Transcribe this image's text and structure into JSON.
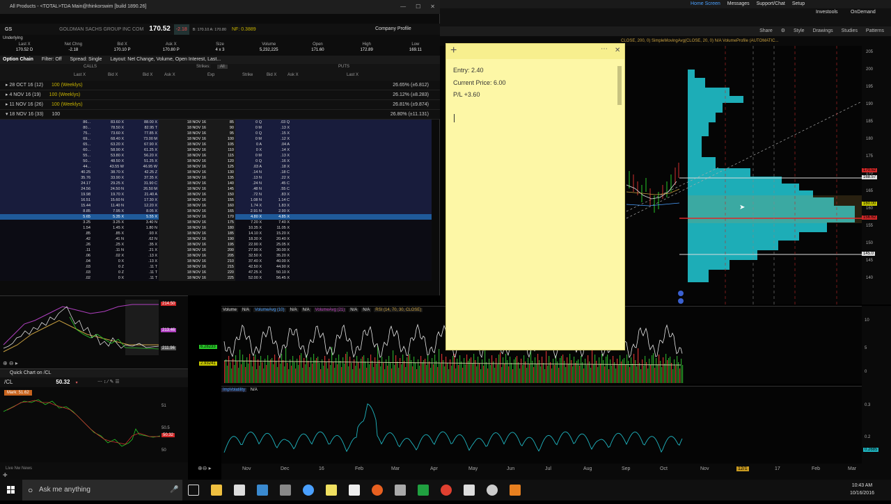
{
  "left_window": {
    "title": "All Products - <TOTAL>TDA Main@thinkorswim [build 1890.26]",
    "symbol": "GS",
    "company": "GOLDMAN SACHS GROUP INC COM",
    "last": "170.52",
    "change": "-2.18",
    "bid_ask": "B: 170.10  A: 170.80",
    "pct": "NF: 0.3889",
    "company_profile": "Company Profile",
    "underlying_label": "Underlying",
    "underlying_headers": [
      "Last X",
      "Net Chng",
      "Bid X",
      "Ask X",
      "Size",
      "Volume",
      "Open",
      "High",
      "Low"
    ],
    "underlying_values": [
      "170.52 D",
      "-2.18",
      "170.10 P",
      "170.80 P",
      "4 x 3",
      "5,232,225",
      "171.60",
      "172.89",
      "169.11"
    ],
    "option_chain_label": "Option Chain",
    "filter": "Filter: Off",
    "spread": "Spread: Single",
    "layout": "Layout: Net Change, Volume, Open Interest, Last...",
    "calls_label": "CALLS",
    "puts_label": "PUTS",
    "strikes_label": "Strikes:",
    "strikes_value": "All",
    "call_cols": [
      "Last X",
      "Net Chng",
      "Bid X",
      "Ask X"
    ],
    "put_cols": [
      "Bid X",
      "Ask X",
      "Last X",
      "Net Chng"
    ],
    "exp_col": "Exp",
    "strike_col": "Strike",
    "expirations": [
      {
        "label": "28 OCT 16",
        "days": "(12)",
        "mult": "100 (Weeklys)",
        "iv": "26.65% (±6.812)"
      },
      {
        "label": "4 NOV 16",
        "days": "(19)",
        "mult": "100 (Weeklys)",
        "iv": "26.12% (±8.283)"
      },
      {
        "label": "11 NOV 16",
        "days": "(26)",
        "mult": "100 (Weeklys)",
        "iv": "26.81% (±9.874)"
      },
      {
        "label": "18 NOV 16",
        "days": "(33)",
        "mult": "100",
        "iv": "26.80% (±11.131)"
      }
    ],
    "chain_rows": [
      {
        "strike": "85",
        "call_last": "86...",
        "call_bid": "83.60 X",
        "call_ask": "88.00 X",
        "put_bid": "0 Q",
        "put_ask": ".03 Q",
        "t": "itm"
      },
      {
        "strike": "90",
        "call_last": "80...",
        "call_bid": "78.50 X",
        "call_ask": "82.95 T",
        "put_bid": "0 M",
        "put_ask": ".13 X",
        "t": "itm"
      },
      {
        "strike": "95",
        "call_last": "75...",
        "call_bid": "73.60 X",
        "call_ask": "77.85 X",
        "put_bid": "0 Q",
        "put_ask": ".15 X",
        "t": "itm"
      },
      {
        "strike": "100",
        "call_last": "69...",
        "call_bid": "68.40 X",
        "call_ask": "73.00 M",
        "put_bid": "0 M",
        "put_ask": ".12 X",
        "t": "itm"
      },
      {
        "strike": "105",
        "call_last": "65...",
        "call_bid": "63.20 X",
        "call_ask": "67.90 X",
        "put_bid": "0 A",
        "put_ask": ".04 A",
        "t": "itm"
      },
      {
        "strike": "110",
        "call_last": "60...",
        "call_bid": "58.90 X",
        "call_ask": "61.25 X",
        "put_bid": "0 X",
        "put_ask": ".14 X",
        "t": "itm"
      },
      {
        "strike": "115",
        "call_last": "55...",
        "call_bid": "53.80 X",
        "call_ask": "56.20 X",
        "put_bid": "0 M",
        "put_ask": ".13 X",
        "t": "itm"
      },
      {
        "strike": "120",
        "call_last": "50...",
        "call_bid": "48.50 X",
        "call_ask": "51.25 X",
        "put_bid": "0 Q",
        "put_ask": ".16 X",
        "t": "itm"
      },
      {
        "strike": "125",
        "call_last": "44...",
        "call_bid": "43.55 W",
        "call_ask": "46.95 W",
        "put_bid": ".03 A",
        "put_ask": ".18 X",
        "t": "itm"
      },
      {
        "strike": "130",
        "call_last": "40.25",
        "call_bid": "38.70 X",
        "call_ask": "42.25 Z",
        "put_bid": ".14 N",
        "put_ask": ".18 C",
        "t": "itm"
      },
      {
        "strike": "135",
        "call_last": "35.76",
        "call_bid": "33.90 X",
        "call_ask": "37.35 X",
        "put_bid": ".13 N",
        "put_ask": ".22 X",
        "t": "itm"
      },
      {
        "strike": "140",
        "call_last": "24.17",
        "call_bid": "29.25 X",
        "call_ask": "31.90 C",
        "put_bid": ".24 N",
        "put_ask": ".45 C",
        "t": "itm"
      },
      {
        "strike": "145",
        "call_last": "24.56",
        "call_bid": "24.50 N",
        "call_ask": "26.50 M",
        "put_bid": ".48 N",
        "put_ask": ".55 C",
        "t": "itm"
      },
      {
        "strike": "150",
        "call_last": "19.98",
        "call_bid": "19.70 X",
        "call_ask": "21.40 A",
        "put_bid": ".72 N",
        "put_ask": ".83 X",
        "t": "itm"
      },
      {
        "strike": "155",
        "call_last": "16.51",
        "call_bid": "15.60 N",
        "call_ask": "17.30 X",
        "put_bid": "1.08 N",
        "put_ask": "1.14 C",
        "t": "itm"
      },
      {
        "strike": "160",
        "call_last": "15.44",
        "call_bid": "11.40 N",
        "call_ask": "12.20 X",
        "put_bid": "1.74 X",
        "put_ask": "1.83 X",
        "t": "itm"
      },
      {
        "strike": "165",
        "call_last": "8.85",
        "call_bid": "7.95 X",
        "call_ask": "8.05 X",
        "put_bid": "2.91 N",
        "put_ask": "2.90 X",
        "t": "itm"
      },
      {
        "strike": "170",
        "call_last": "5.65",
        "call_bid": "5.35 X",
        "call_ask": "5.55 X",
        "put_bid": "4.80 X",
        "put_ask": "4.85 X",
        "t": "sel"
      },
      {
        "strike": "175",
        "call_last": "3.25",
        "call_bid": "3.25 X",
        "call_ask": "3.40 N",
        "put_bid": "7.20 X",
        "put_ask": "7.40 X",
        "t": "otm"
      },
      {
        "strike": "180",
        "call_last": "1.54",
        "call_bid": "1.45 X",
        "call_ask": "1.80 N",
        "put_bid": "10.35 X",
        "put_ask": "11.05 X",
        "t": "otm"
      },
      {
        "strike": "185",
        "call_last": ".85",
        "call_bid": ".85 X",
        "call_ask": ".93 X",
        "put_bid": "14.10 X",
        "put_ask": "15.20 X",
        "t": "otm"
      },
      {
        "strike": "190",
        "call_last": ".42",
        "call_bid": ".41 N",
        "call_ask": ".62 N",
        "put_bid": "18.30 X",
        "put_ask": "20.40 X",
        "t": "otm"
      },
      {
        "strike": "195",
        "call_last": ".26",
        "call_bid": ".25 X",
        "call_ask": ".35 X",
        "put_bid": "22.90 X",
        "put_ask": "25.05 X",
        "t": "otm"
      },
      {
        "strike": "200",
        "call_last": ".11",
        "call_bid": ".11 N",
        "call_ask": ".21 X",
        "put_bid": "27.90 X",
        "put_ask": "30.00 X",
        "t": "otm"
      },
      {
        "strike": "205",
        "call_last": ".06",
        "call_bid": ".02 X",
        "call_ask": ".13 X",
        "put_bid": "32.50 X",
        "put_ask": "35.20 X",
        "t": "otm"
      },
      {
        "strike": "210",
        "call_last": ".04",
        "call_bid": "0 X",
        "call_ask": ".13 X",
        "put_bid": "37.40 X",
        "put_ask": "40.00 X",
        "t": "otm"
      },
      {
        "strike": "215",
        "call_last": ".03",
        "call_bid": "0 Z",
        "call_ask": ".11 T",
        "put_bid": "42.50 X",
        "put_ask": "44.90 X",
        "t": "otm"
      },
      {
        "strike": "220",
        "call_last": ".03",
        "call_bid": "0 Z",
        "call_ask": ".11 T",
        "put_bid": "47.25 X",
        "put_ask": "50.10 X",
        "t": "otm"
      },
      {
        "strike": "225",
        "call_last": ".02",
        "call_bid": "0 X",
        "call_ask": ".11 T",
        "put_bid": "52.00 X",
        "put_ask": "56.45 X",
        "t": "otm"
      }
    ],
    "chain_exp": "18 NOV 16"
  },
  "mini_chart": {
    "labels": [
      "214.50",
      "213.46",
      "211.96"
    ]
  },
  "quick_chart": {
    "title": "Quick Chart on /CL",
    "symbol": "/CL",
    "price": "50.32",
    "tag": "Mark: 51.62",
    "labels": [
      "51",
      "50.5",
      "50"
    ]
  },
  "bottom_left": {
    "label": "Live Nw News"
  },
  "topbar": {
    "items": [
      "Home Screen",
      "Messages",
      "Support/Chat",
      "Setup"
    ],
    "right_items": [
      "Investools",
      "OnDemand"
    ]
  },
  "chart_toolbar": {
    "items": [
      "Share",
      "Style",
      "Drawings",
      "Studies",
      "Patterns"
    ]
  },
  "study_row": "CLOSE, 200, 0)   SimpleMovingAvg(CLOSE, 20, 0)   N/A   VolumeProfile (AUTOMATIC...",
  "price_axis": [
    "205",
    "200",
    "195",
    "190",
    "185",
    "180",
    "175",
    "170",
    "165",
    "160",
    "155",
    "150",
    "145",
    "140"
  ],
  "price_tags": [
    {
      "label": "170.52",
      "color": "#d02828"
    },
    {
      "label": "168.57",
      "color": "#e0e0e0"
    },
    {
      "label": "160.00",
      "color": "#c8c800"
    },
    {
      "label": "156.62",
      "color": "#d02828"
    },
    {
      "label": "145.0",
      "color": "#e0e0e0"
    }
  ],
  "volume_header": [
    "Volume",
    "N/A",
    "VolumeAvg (10)",
    "N/A",
    "N/A",
    "VolumeAvg (21)",
    "N/A",
    "N/A",
    "RSI (14, 70, 30, CLOSE)"
  ],
  "volume_tags": [
    "6.28233",
    "2.93241"
  ],
  "volume_axis": [
    "10",
    "5",
    "0"
  ],
  "iv_header": [
    "ImpVolatility",
    "N/A"
  ],
  "iv_axis": [
    "0.3",
    "0.2"
  ],
  "iv_tag": "0.2685",
  "x_axis": [
    "Nov",
    "Dec",
    "16",
    "Feb",
    "Mar",
    "Apr",
    "May",
    "Jun",
    "Jul",
    "Aug",
    "Sep",
    "Oct",
    "Nov",
    "12/1",
    "17",
    "Feb",
    "Mar"
  ],
  "sticky_note": {
    "lines": [
      "Entry: 2.40",
      "Current Price: 6.00",
      "P/L +3.60"
    ]
  },
  "taskbar": {
    "search_placeholder": "Ask me anything",
    "time": "10:43 AM",
    "date": "10/16/2016"
  },
  "colors": {
    "profile": "#1fb6c1",
    "itm": "#181c3c",
    "selected": "#1f5a9a",
    "sticky": "#fdf7a6"
  }
}
